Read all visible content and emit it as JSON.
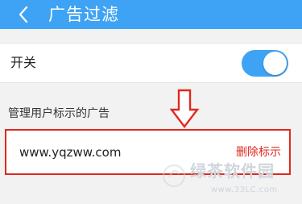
{
  "header": {
    "title": "广告过滤",
    "background_color": "#3ea3f4"
  },
  "switch_row": {
    "label": "开关",
    "toggle_state": "on",
    "toggle_color": "#3ea3f4"
  },
  "section": {
    "title": "管理用户标示的广告"
  },
  "entries": [
    {
      "domain": "www.yqzww.com",
      "delete_label": "删除标示"
    }
  ],
  "annotation": {
    "color": "#e2281d"
  },
  "watermark": {
    "text": "绿茶软件园",
    "url": "www.33LC.com"
  }
}
